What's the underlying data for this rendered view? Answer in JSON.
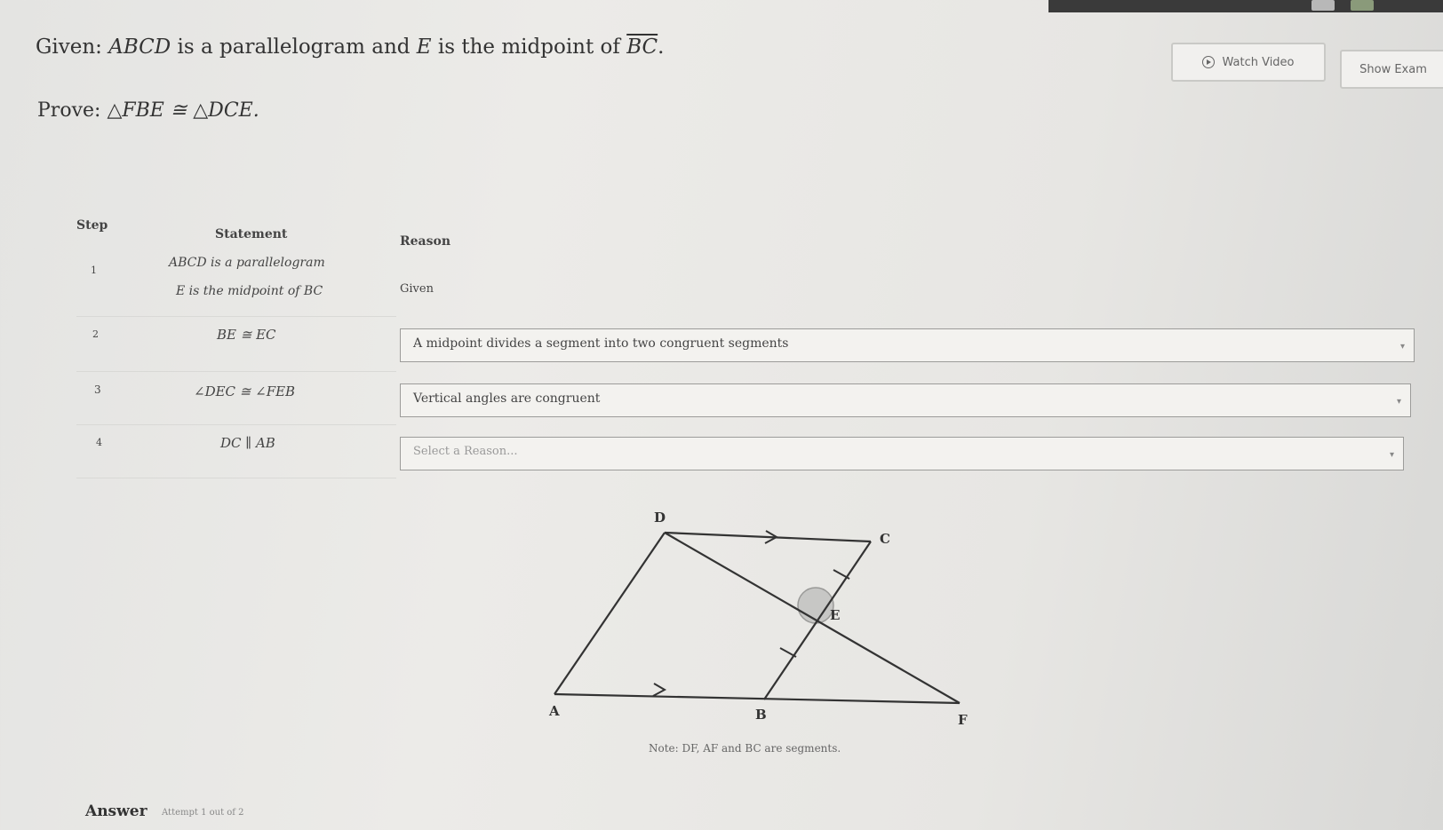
{
  "header": {
    "given_prefix": "Given:",
    "given_quad": "ABCD",
    "given_mid": "is a parallelogram and",
    "given_point": "E",
    "given_suffix": "is the midpoint of",
    "given_segment": "BC",
    "given_end": ".",
    "prove_prefix": "Prove:",
    "prove_statement": "△FBE ≅ △DCE."
  },
  "buttons": {
    "watch_video": "Watch Video",
    "show_examples": "Show Exam"
  },
  "table": {
    "headers": {
      "step": "Step",
      "statement": "Statement",
      "reason": "Reason"
    },
    "rows": [
      {
        "step": "1",
        "statement_line1": "ABCD is a parallelogram",
        "statement_line2": "E is the midpoint of BC",
        "reason": "Given"
      },
      {
        "step": "2",
        "statement": "BE ≅ EC",
        "reason": "A midpoint divides a segment into two congruent segments"
      },
      {
        "step": "3",
        "statement": "∠DEC ≅ ∠FEB",
        "reason": "Vertical angles are congruent"
      },
      {
        "step": "4",
        "statement": "DC ∥ AB",
        "reason": "",
        "reason_placeholder": "Select a Reason..."
      }
    ]
  },
  "diagram": {
    "labels": {
      "D": "D",
      "C": "C",
      "E": "E",
      "A": "A",
      "B": "B",
      "F": "F"
    }
  },
  "note": "Note: DF, AF and BC are segments.",
  "footer": {
    "answer_label": "Answer",
    "attempt_text": "Attempt 1 out of 2"
  },
  "colors": {
    "background": "#e9e8e5",
    "text": "#333333",
    "border": "#9c9c9a",
    "angle_mark": "#bdbdbd"
  },
  "icons": [
    "play-icon",
    "dropdown-caret-icon"
  ]
}
